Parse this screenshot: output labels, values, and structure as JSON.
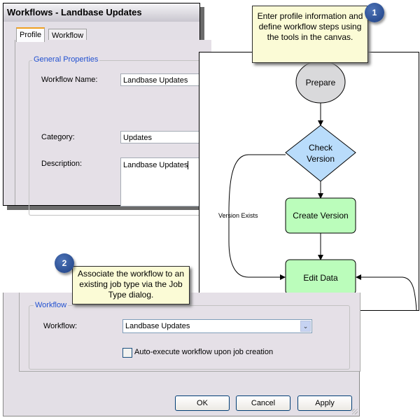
{
  "profile_dialog": {
    "title": "Workflows - Landbase Updates",
    "tabs": [
      {
        "label": "Profile",
        "active": true
      },
      {
        "label": "Workflow",
        "active": false
      }
    ],
    "group_label": "General Properties",
    "fields": {
      "workflow_name_label": "Workflow Name:",
      "workflow_name_value": "Landbase Updates",
      "category_label": "Category:",
      "category_value": "Updates",
      "description_label": "Description:",
      "description_value": "Landbase Updates"
    }
  },
  "callouts": [
    {
      "number": "1",
      "text": "Enter profile information and define workflow steps using the tools in the canvas."
    },
    {
      "number": "2",
      "text": "Associate the workflow to an existing job type via the Job Type dialog."
    }
  ],
  "workflow_canvas": {
    "nodes": [
      {
        "id": "prepare",
        "label": "Prepare",
        "shape": "ellipse",
        "color": "#d9d9db"
      },
      {
        "id": "check_version",
        "label_line1": "Check",
        "label_line2": "Version",
        "shape": "diamond",
        "color": "#b9dcfb"
      },
      {
        "id": "create_version",
        "label": "Create Version",
        "shape": "rounded-rect",
        "color": "#bbfdbb"
      },
      {
        "id": "edit_data",
        "label": "Edit Data",
        "shape": "rounded-rect",
        "color": "#bbfdbb"
      }
    ],
    "edge_labels": {
      "version_exists": "Version Exists"
    }
  },
  "job_type_dialog": {
    "group_label": "Workflow",
    "workflow_label": "Workflow:",
    "workflow_selected": "Landbase Updates",
    "auto_execute_label": "Auto-execute workflow upon job creation",
    "auto_execute_checked": false,
    "buttons": {
      "ok": "OK",
      "cancel": "Cancel",
      "apply": "Apply"
    }
  }
}
